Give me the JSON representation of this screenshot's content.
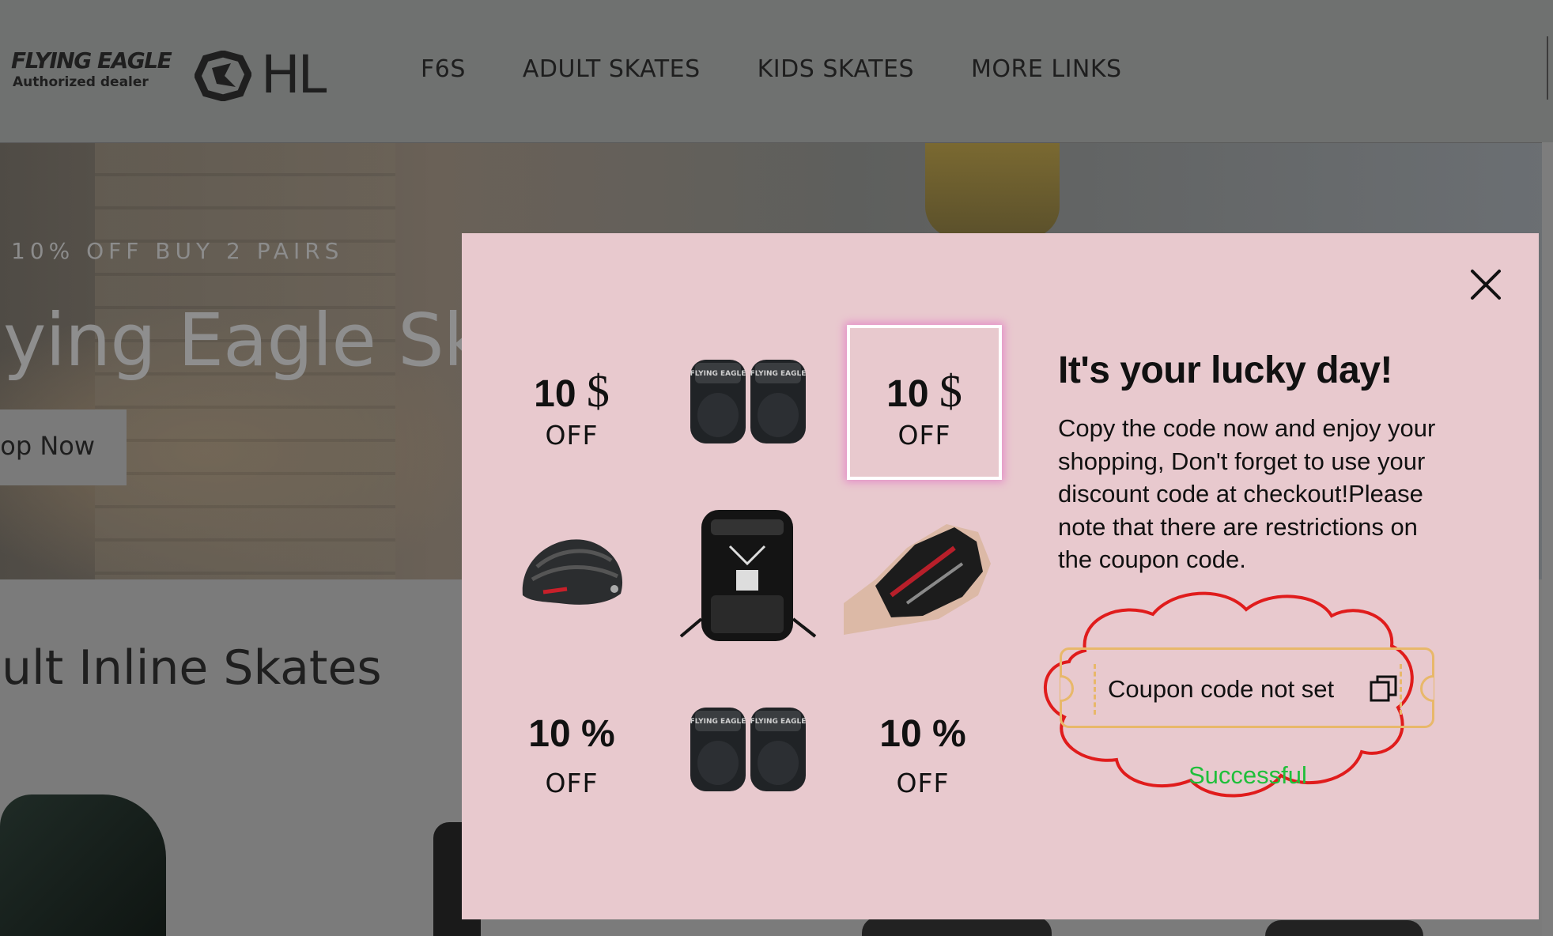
{
  "header": {
    "logo": {
      "brand": "FLYING EAGLE",
      "subtitle": "Authorized dealer",
      "mark": "HL"
    },
    "nav": [
      "F6S",
      "ADULT SKATES",
      "KIDS SKATES",
      "MORE LINKS"
    ]
  },
  "hero": {
    "promo": "10% OFF BUY 2 PAIRS",
    "title": "ying Eagle Sk",
    "button_label": "op Now"
  },
  "section": {
    "title": "ult Inline Skates"
  },
  "popup": {
    "close_icon": "close-icon",
    "prizes": [
      {
        "value": "10",
        "symbol": "$",
        "label": "OFF"
      },
      {
        "image": "knee-pads",
        "brand": "FLYING EAGLE"
      },
      {
        "value": "10",
        "symbol": "$",
        "label": "OFF",
        "selected": true
      },
      {
        "image": "helmet"
      },
      {
        "image": "backpack"
      },
      {
        "image": "glove"
      },
      {
        "value": "10",
        "symbol": "%",
        "label": "OFF"
      },
      {
        "image": "knee-pads",
        "brand": "FLYING EAGLE"
      },
      {
        "value": "10",
        "symbol": "%",
        "label": "OFF"
      }
    ],
    "title": "It's your lucky day!",
    "description": "Copy the code now and enjoy your shopping, Don't forget to use your discount code at checkout!Please note that there are restrictions on the coupon code.",
    "coupon_text": "Coupon code not set",
    "copy_icon": "copy-icon",
    "status": "Successful",
    "colors": {
      "popup_bg": "#e8c9ce",
      "coupon_border": "#e8b86a",
      "success": "#1fbf3a",
      "highlight": "#e01c1c"
    }
  }
}
